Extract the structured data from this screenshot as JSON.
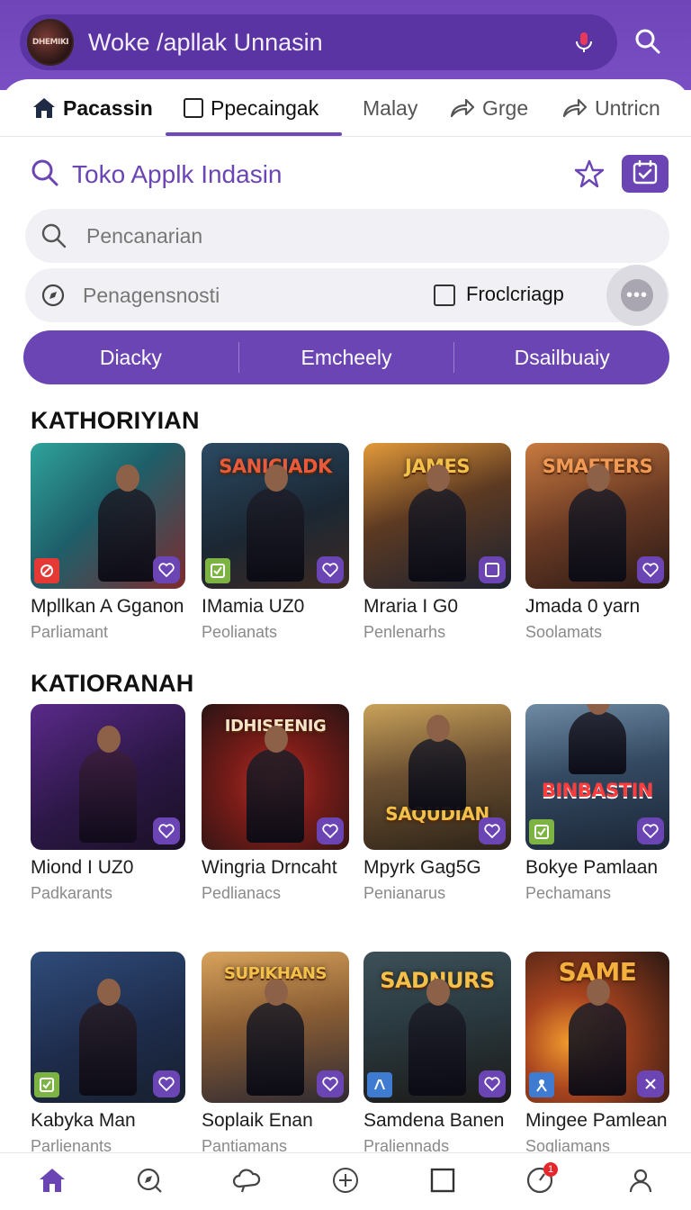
{
  "header": {
    "logo_text": "DHEMIKI",
    "title": "Woke /apllak Unnasin"
  },
  "tabs": [
    {
      "label": "Pacassin",
      "icon": "home-icon"
    },
    {
      "label": "Ppecaingak",
      "icon": "checkbox-icon"
    },
    {
      "label": "Malay",
      "icon": ""
    },
    {
      "label": "Grge",
      "icon": "share-icon"
    },
    {
      "label": "Untricn",
      "icon": "share-icon"
    }
  ],
  "store": {
    "title": "Toko Applk Indasin"
  },
  "search": {
    "placeholder": "Pencanarian"
  },
  "filter": {
    "placeholder": "Penagensnosti",
    "checkbox_label": "Froclcriagp"
  },
  "segments": [
    "Diacky",
    "Emcheely",
    "Dsailbuaiy"
  ],
  "sections": [
    {
      "title": "KATHORIYIAN",
      "cards": [
        {
          "title": "Mpllkan A Gganon",
          "sub": "Parliamant",
          "banner": "",
          "badge": "red"
        },
        {
          "title": "IMamia UZ0",
          "sub": "Peolianats",
          "banner": "SANICIADK",
          "badge": "green"
        },
        {
          "title": "Mraria I G0",
          "sub": "Penlenarhs",
          "banner": "JAMES",
          "badge": "none"
        },
        {
          "title": "Jmada 0 yarn",
          "sub": "Soolamats",
          "banner": "SMAETERS",
          "badge": "none"
        }
      ]
    },
    {
      "title": "KATIORANAH",
      "cards": [
        {
          "title": "Miond I UZ0",
          "sub": "Padkarants",
          "banner": "",
          "badge": "none"
        },
        {
          "title": "Wingria Drncaht",
          "sub": "Pedlianacs",
          "banner": "IDHISEENIG",
          "badge": "none"
        },
        {
          "title": "Mpyrk Gag5G",
          "sub": "Penianarus",
          "banner": "SAQUDIAN",
          "badge": "none"
        },
        {
          "title": "Bokye Pamlaan",
          "sub": "Pechamans",
          "banner": "BINBASTIN",
          "badge": "green"
        }
      ]
    },
    {
      "title": "",
      "cards": [
        {
          "title": "Kabyka Man",
          "sub": "Parlienants",
          "banner": "",
          "badge": "green"
        },
        {
          "title": "Soplaik Enan",
          "sub": "Pantiamans",
          "banner": "SUPIKHANS",
          "badge": "none"
        },
        {
          "title": "Samdena Banen",
          "sub": "Praliennads",
          "banner": "SADNURS",
          "badge": "blue"
        },
        {
          "title": "Mingee Pamlean",
          "sub": "Soqliamans",
          "banner": "SAME",
          "badge": "blue"
        }
      ]
    }
  ],
  "bottom_nav": [
    {
      "icon": "home-icon",
      "active": true
    },
    {
      "icon": "explore-icon"
    },
    {
      "icon": "cloud-icon"
    },
    {
      "icon": "add-circle-icon"
    },
    {
      "icon": "square-icon"
    },
    {
      "icon": "notification-icon",
      "badge": "1"
    },
    {
      "icon": "profile-icon"
    }
  ],
  "colors": {
    "accent": "#6b45b4",
    "header": "#7a4fc4"
  }
}
